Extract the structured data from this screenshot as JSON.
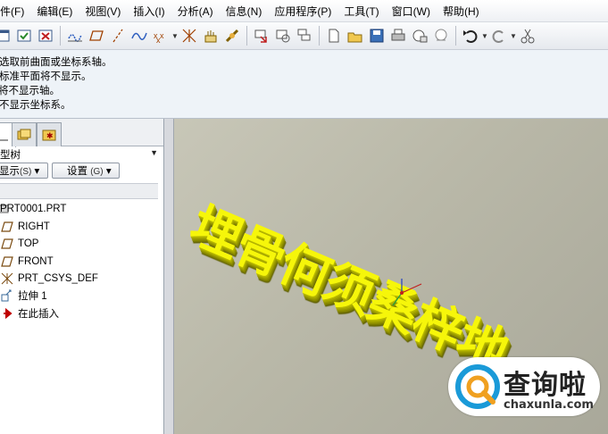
{
  "menu": [
    "件(F)",
    "编辑(E)",
    "视图(V)",
    "插入(I)",
    "分析(A)",
    "信息(N)",
    "应用程序(P)",
    "工具(T)",
    "窗口(W)",
    "帮助(H)"
  ],
  "messages": [
    "选取前曲面或坐标系轴。",
    "标准平面将不显示。",
    "将不显示轴。",
    "不显示坐标系。"
  ],
  "panel": {
    "tree_title": "型树",
    "show_label": "显示",
    "show_key": "(S)",
    "settings_label": "设置",
    "settings_key": "(G)"
  },
  "tree": [
    {
      "label": "PRT0001.PRT",
      "icon": "part-icon"
    },
    {
      "label": "RIGHT",
      "icon": "datum-plane-icon"
    },
    {
      "label": "TOP",
      "icon": "datum-plane-icon"
    },
    {
      "label": "FRONT",
      "icon": "datum-plane-icon"
    },
    {
      "label": "PRT_CSYS_DEF",
      "icon": "coordinate-system-icon"
    },
    {
      "label": "拉伸 1",
      "icon": "extrude-icon"
    },
    {
      "label": "在此插入",
      "icon": "insert-here-arrow-icon"
    }
  ],
  "model_text": "埋骨何须桑梓地",
  "watermark": {
    "name": "查询啦",
    "url": "chaxunla.com"
  },
  "colors": {
    "model": "#f6f60a",
    "background": "#b9b8a8",
    "insert_arrow": "#c00000"
  }
}
